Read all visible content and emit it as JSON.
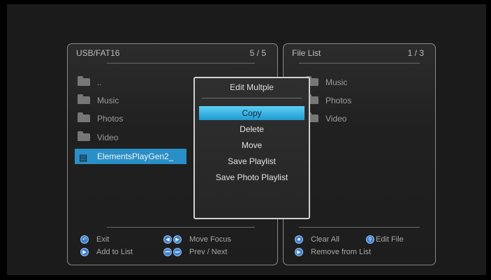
{
  "left_panel": {
    "title": "USB/FAT16",
    "count": "5 / 5",
    "items": [
      {
        "label": "..",
        "icon": "folder-up-icon"
      },
      {
        "label": "Music",
        "icon": "folder-icon"
      },
      {
        "label": "Photos",
        "icon": "folder-icon"
      },
      {
        "label": "Video",
        "icon": "folder-icon"
      },
      {
        "label": "ElementsPlayGen2_",
        "icon": "camera-icon",
        "selected": true
      }
    ]
  },
  "right_panel": {
    "title": "File List",
    "count": "1 / 3",
    "items": [
      {
        "label": "Music",
        "icon": "folder-icon"
      },
      {
        "label": "Photos",
        "icon": "folder-icon"
      },
      {
        "label": "Video",
        "icon": "folder-icon"
      }
    ]
  },
  "popup": {
    "title": "Edit Multple",
    "options": [
      "Copy",
      "Delete",
      "Move",
      "Save Playlist",
      "Save Photo Playlist"
    ],
    "highlighted": "Copy"
  },
  "footer_left": {
    "exit": "Exit",
    "add_to_list": "Add to List",
    "move_focus": "Move Focus",
    "prev_next": "Prev / Next"
  },
  "footer_right": {
    "clear_all": "Clear All",
    "edit_file": "Edit File",
    "remove_from_list": "Remove from List"
  },
  "colors": {
    "selection": "#2a8fc7",
    "highlight": "#3fb6e6",
    "button": "#3b7fd0"
  }
}
